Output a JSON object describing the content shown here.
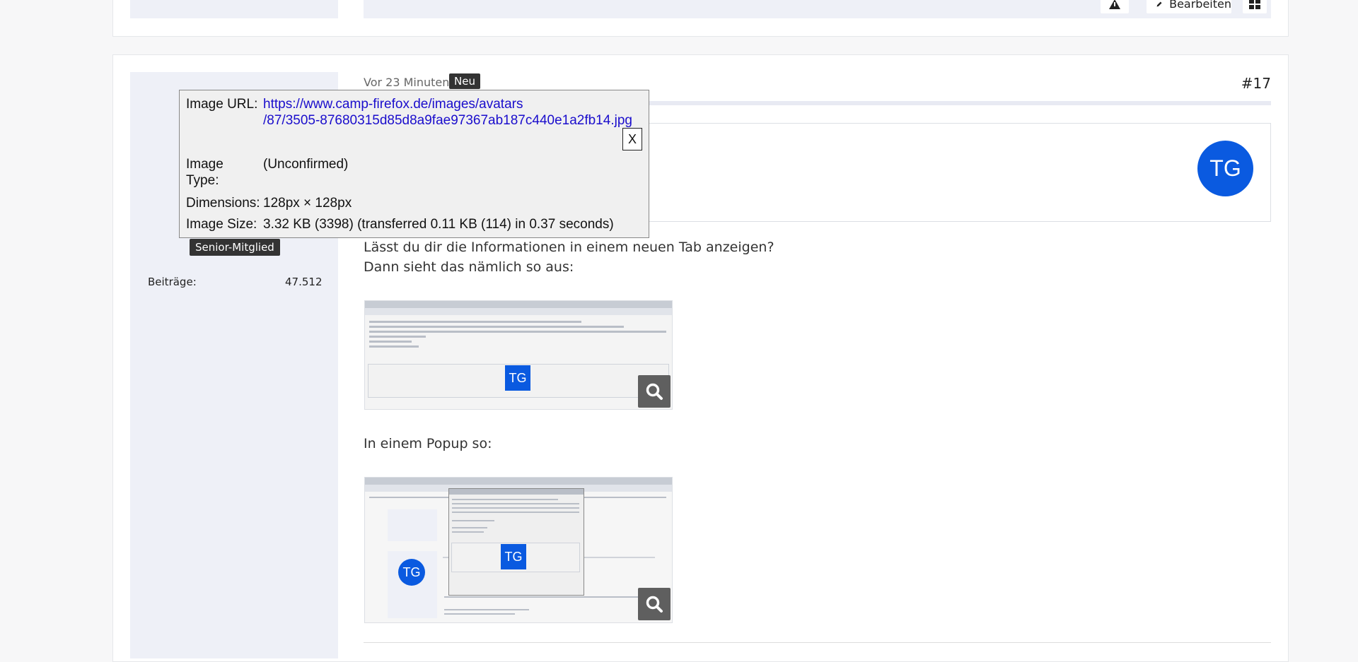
{
  "previous_post": {
    "edit_label": "Bearbeiten"
  },
  "post": {
    "time": "Vor 23 Minuten",
    "new_badge": "Neu",
    "number": "#17",
    "avatar_initials": "TG",
    "author": {
      "rank": "Senior-Mitglied",
      "stats_label": "Beiträge",
      "stats_colon": ":",
      "stats_value": "47.512"
    },
    "paragraph1_line1": "Lässt du dir die Informationen in einem neuen Tab anzeigen?",
    "paragraph1_line2": "Dann sieht das nämlich so aus:",
    "paragraph2": "In einem Popup so:",
    "thumbnail1_tg": "TG",
    "thumbnail2_tg_avatar": "TG",
    "thumbnail2_tg_square": "TG"
  },
  "image_info_popup": {
    "url_label": "Image URL:",
    "url_line1": "https://www.camp-firefox.de/images/avatars",
    "url_line2": "/87/3505-87680315d85d8a9fae97367ab187c440e1a2fb14.jpg",
    "close_label": "X",
    "type_label_line1": "Image",
    "type_label_line2": "Type:",
    "type_value": "(Unconfirmed)",
    "dimensions_label": "Dimensions:",
    "dimensions_value": "128px × 128px",
    "size_label": "Image Size:",
    "size_value": "3.32 KB (3398) (transferred 0.11 KB (114) in 0.37 seconds)"
  },
  "colors": {
    "accent_blue": "#0a5ae0",
    "badge_dark": "#333333",
    "link_blue": "#1a0dcc",
    "sidebar_bg": "#eef0f7"
  },
  "icons": {
    "warning": "warning-icon",
    "edit": "pencil-icon",
    "grid": "grid-icon",
    "zoom": "search-icon"
  }
}
